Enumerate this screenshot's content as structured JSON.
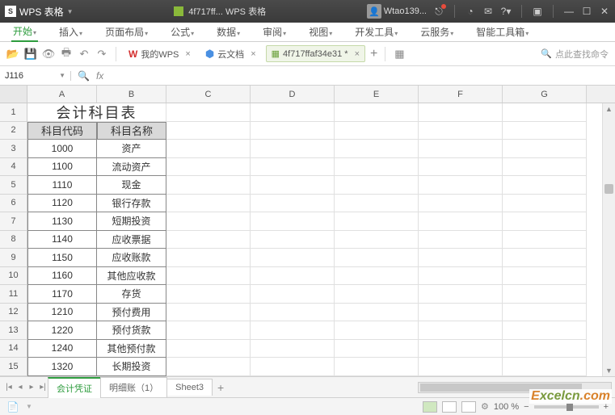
{
  "titlebar": {
    "app_name": "WPS 表格",
    "doc_title": "4f717ff... WPS 表格",
    "user_name": "Wtao139...",
    "dash": "—"
  },
  "ribbon": {
    "tabs": [
      "开始",
      "插入",
      "页面布局",
      "公式",
      "数据",
      "审阅",
      "视图",
      "开发工具",
      "云服务",
      "智能工具箱"
    ],
    "active_index": 0
  },
  "toolbar": {
    "my_wps": "我的WPS",
    "cloud_doc": "云文档",
    "active_doc": "4f717ffaf34e31 *",
    "search_placeholder": "点此查找命令"
  },
  "formula": {
    "cell_ref": "J116",
    "fx_label": "fx",
    "value": ""
  },
  "columns": [
    "A",
    "B",
    "C",
    "D",
    "E",
    "F",
    "G"
  ],
  "row_numbers": [
    1,
    2,
    3,
    4,
    5,
    6,
    7,
    8,
    9,
    10,
    11,
    12,
    13,
    14,
    15
  ],
  "sheet": {
    "title_merged": "会计科目表",
    "headers": [
      "科目代码",
      "科目名称"
    ],
    "rows": [
      [
        "1000",
        "资产"
      ],
      [
        "1100",
        "流动资产"
      ],
      [
        "1110",
        "现金"
      ],
      [
        "1120",
        "银行存款"
      ],
      [
        "1130",
        "短期投资"
      ],
      [
        "1140",
        "应收票据"
      ],
      [
        "1150",
        "应收账款"
      ],
      [
        "1160",
        "其他应收款"
      ],
      [
        "1170",
        "存货"
      ],
      [
        "1210",
        "预付费用"
      ],
      [
        "1220",
        "预付货款"
      ],
      [
        "1240",
        "其他预付款"
      ],
      [
        "1320",
        "长期投资"
      ]
    ]
  },
  "sheet_tabs": {
    "tabs": [
      "会计凭证",
      "明细账（1）",
      "Sheet3"
    ],
    "active_index": 0
  },
  "statusbar": {
    "zoom": "100 %"
  },
  "watermark": {
    "t1": "E",
    "t2": "xcelcn",
    "t3": ".com"
  }
}
